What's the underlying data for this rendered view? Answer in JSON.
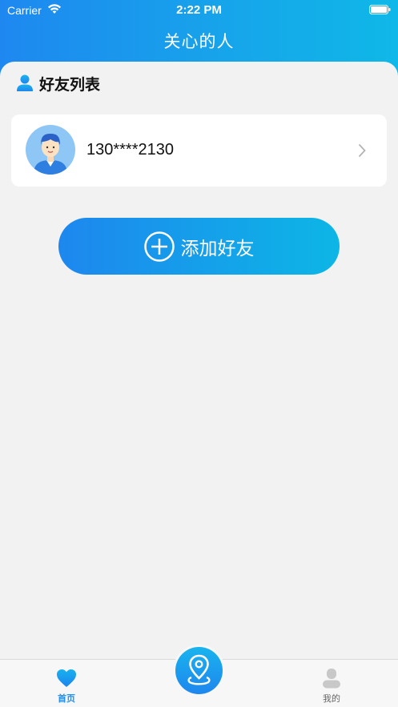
{
  "status_bar": {
    "carrier": "Carrier",
    "time": "2:22 PM"
  },
  "nav": {
    "title": "关心的人"
  },
  "section": {
    "title": "好友列表",
    "icon": "person-icon"
  },
  "friends": [
    {
      "phone": "130****2130",
      "avatar": "avatar-icon"
    }
  ],
  "add_friend": {
    "label": "添加好友",
    "icon": "plus-circle-icon"
  },
  "tab_bar": {
    "home_label": "首页",
    "mine_label": "我的",
    "center_icon": "location-pin-icon",
    "active_color": "#1e8ff0"
  },
  "colors": {
    "brand_gradient_start": "#1e88f0",
    "brand_gradient_end": "#0fb8e8",
    "background": "#f2f2f2"
  }
}
